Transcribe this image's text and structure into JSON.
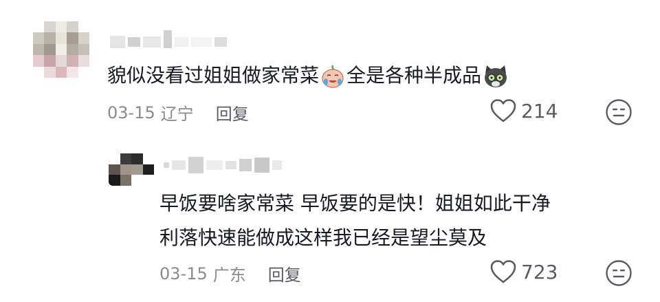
{
  "comments": [
    {
      "text_parts": [
        "貌似没看过姐姐做家常菜",
        "全是各种半成品"
      ],
      "emoji_1": "crying-face-emoji",
      "emoji_2": "cat-face-emoji",
      "date": "03-15",
      "location": "辽宁",
      "reply_label": "回复",
      "likes": "214",
      "like_icon": "heart-outline-icon",
      "dislike_icon": "expressionless-face-icon"
    },
    {
      "lines": [
        "早饭要啥家常菜 早饭要的是快！姐姐如此干净",
        "利落快速能做成这样我已经是望尘莫及"
      ],
      "date": "03-15",
      "location": "广东",
      "reply_label": "回复",
      "likes": "723",
      "like_icon": "heart-outline-icon",
      "dislike_icon": "expressionless-face-icon"
    }
  ],
  "colors": {
    "text": "#161823",
    "meta": "#8a8b91",
    "action": "#5a5b62",
    "background": "#ffffff"
  }
}
